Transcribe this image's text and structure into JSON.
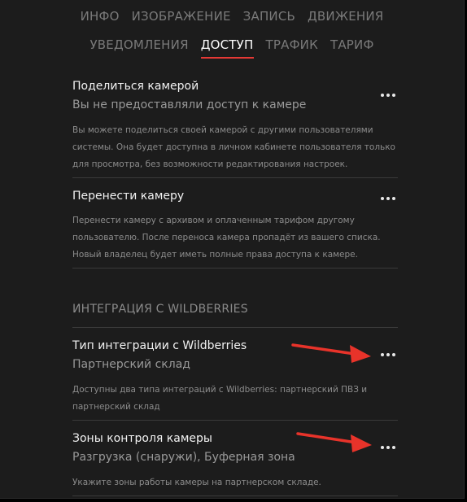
{
  "tabs": {
    "row1": [
      "ИНФО",
      "ИЗОБРАЖЕНИЕ",
      "ЗАПИСЬ",
      "ДВИЖЕНИЯ"
    ],
    "row2": [
      "УВЕДОМЛЕНИЯ",
      "ДОСТУП",
      "ТРАФИК",
      "ТАРИФ"
    ],
    "active": "ДОСТУП"
  },
  "share": {
    "title": "Поделиться камерой",
    "subtitle": "Вы не предоставляли доступ к камере",
    "description": "Вы можете поделиться своей камерой с другими пользователями системы. Она будет доступна в личном кабинете пользователя только для просмотра, без возможности редактирования настроек."
  },
  "transfer": {
    "title": "Перенести камеру",
    "description": "Перенести камеру с архивом и оплаченным тарифом другому пользователю. После переноса камера пропадёт из вашего списка. Новый владелец будет иметь полные права доступа к камере."
  },
  "integration": {
    "header": "ИНТЕГРАЦИЯ С WILDBERRIES",
    "type": {
      "title": "Тип интеграции с Wildberries",
      "subtitle": "Партнерский склад",
      "description": "Доступны два типа интеграций с Wildberries: партнерский ПВЗ и партнерский склад"
    },
    "zones": {
      "title": "Зоны контроля камеры",
      "subtitle": "Разгрузка (снаружи), Буферная зона",
      "description": "Укажите зоны работы камеры на партнерском складе."
    }
  },
  "icons": {
    "more": "more-horizontal-icon",
    "annotation_arrow": "red-arrow-icon"
  },
  "colors": {
    "background": "#1c1c1c",
    "accent": "#e53935",
    "arrow": "#e8332a",
    "text_primary": "#f2f2f2",
    "text_secondary": "#999999"
  }
}
